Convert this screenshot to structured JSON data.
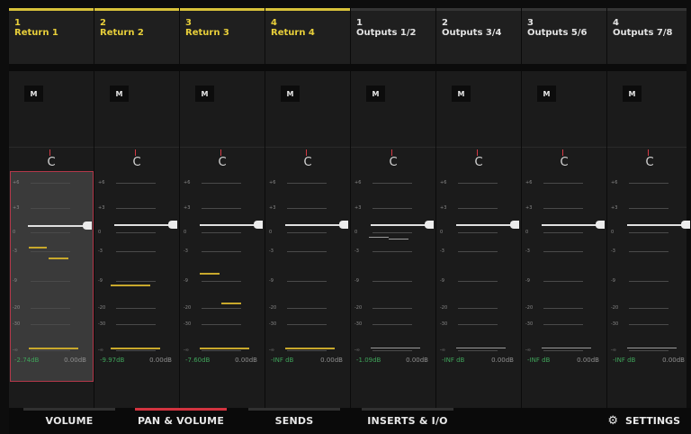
{
  "channels": [
    {
      "num": "1",
      "name": "Return 1",
      "type": "return",
      "mute": "M",
      "pan": "C",
      "peak": "-2.74dB",
      "volume": "0.00dB"
    },
    {
      "num": "2",
      "name": "Return 2",
      "type": "return",
      "mute": "M",
      "pan": "C",
      "peak": "-9.97dB",
      "volume": "0.00dB"
    },
    {
      "num": "3",
      "name": "Return 3",
      "type": "return",
      "mute": "M",
      "pan": "C",
      "peak": "-7.60dB",
      "volume": "0.00dB"
    },
    {
      "num": "4",
      "name": "Return 4",
      "type": "return",
      "mute": "M",
      "pan": "C",
      "peak": "-INF dB",
      "volume": "0.00dB"
    },
    {
      "num": "1",
      "name": "Outputs 1/2",
      "type": "output",
      "mute": "M",
      "pan": "C",
      "peak": "-1.09dB",
      "volume": "0.00dB"
    },
    {
      "num": "2",
      "name": "Outputs 3/4",
      "type": "output",
      "mute": "M",
      "pan": "C",
      "peak": "-INF dB",
      "volume": "0.00dB"
    },
    {
      "num": "3",
      "name": "Outputs 5/6",
      "type": "output",
      "mute": "M",
      "pan": "C",
      "peak": "-INF dB",
      "volume": "0.00dB"
    },
    {
      "num": "4",
      "name": "Outputs 7/8",
      "type": "output",
      "mute": "M",
      "pan": "C",
      "peak": "-INF dB",
      "volume": "0.00dB"
    }
  ],
  "scale_labels": [
    "+6",
    "+3",
    "0",
    "-3",
    "-9",
    "-20",
    "-30",
    "-∞"
  ],
  "tabs": [
    {
      "label": "VOLUME",
      "active": false
    },
    {
      "label": "PAN & VOLUME",
      "active": true
    },
    {
      "label": "SENDS",
      "active": false
    },
    {
      "label": "INSERTS & I/O",
      "active": false
    }
  ],
  "settings": {
    "label": "SETTINGS",
    "icon": "gear-icon"
  },
  "colors": {
    "return": "#e8cf3a",
    "output": "#e2e2e2",
    "accent": "#d2333f",
    "peak": "#3fa35a",
    "meter": "#c8a82c"
  },
  "selected_channel": 0
}
